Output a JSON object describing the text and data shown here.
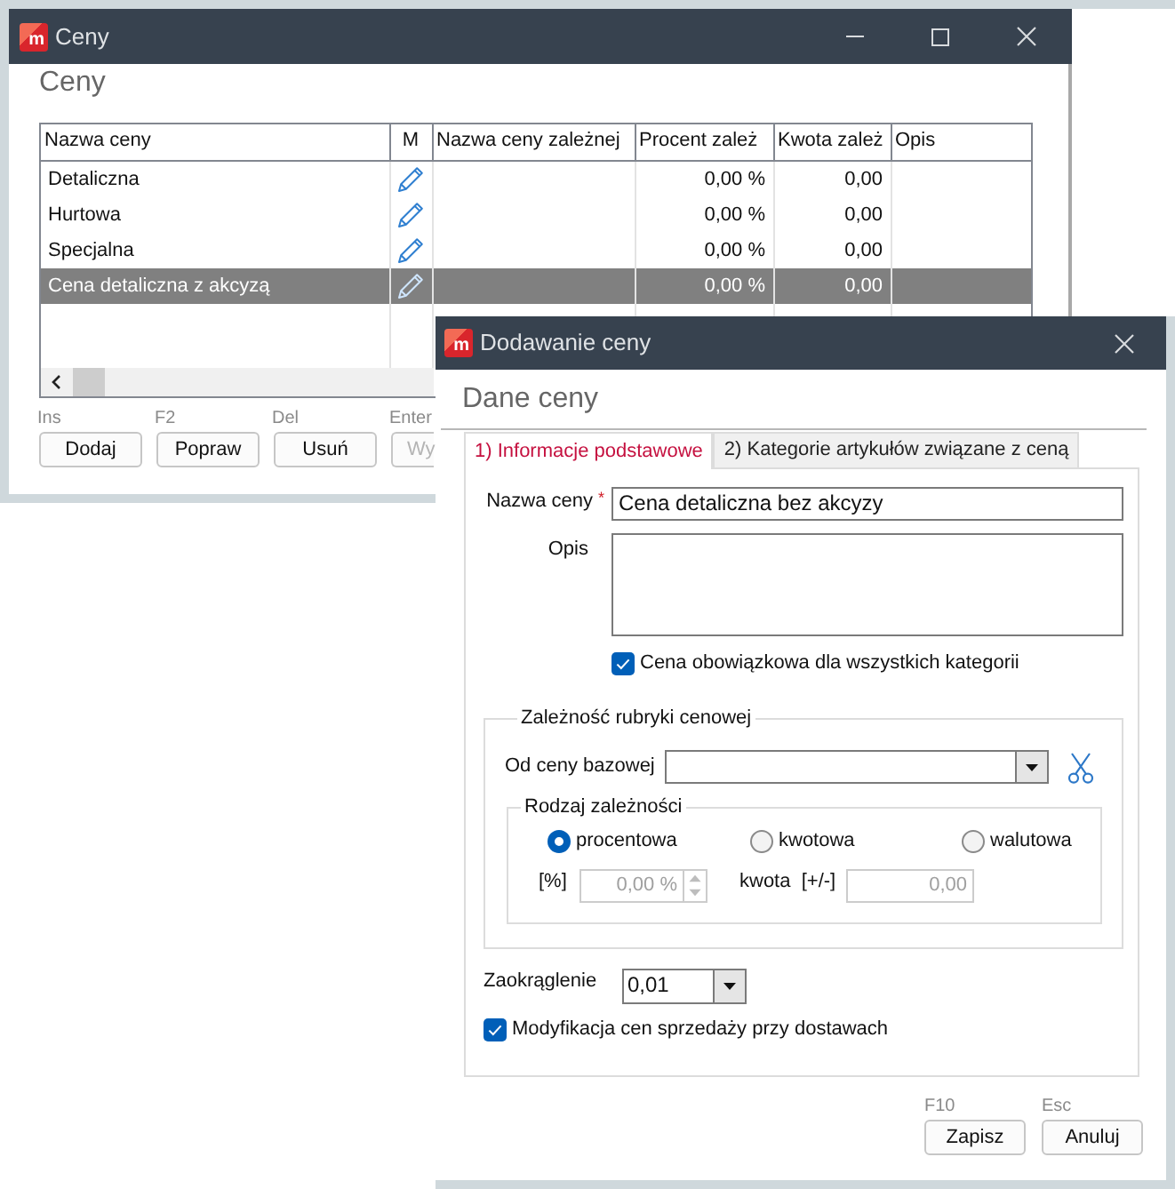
{
  "main_window": {
    "logo": "m",
    "title": "Ceny",
    "heading": "Ceny",
    "table": {
      "columns": [
        "Nazwa ceny",
        "M",
        "Nazwa ceny zależnej",
        "Procent zależ",
        "Kwota zależ",
        "Opis"
      ],
      "rows": [
        {
          "name": "Detaliczna",
          "percent": "0,00 %",
          "amount": "0,00",
          "selected": false
        },
        {
          "name": "Hurtowa",
          "percent": "0,00 %",
          "amount": "0,00",
          "selected": false
        },
        {
          "name": "Specjalna",
          "percent": "0,00 %",
          "amount": "0,00",
          "selected": false
        },
        {
          "name": "Cena detaliczna z akcyzą",
          "percent": "0,00 %",
          "amount": "0,00",
          "selected": true
        }
      ]
    },
    "actions": [
      {
        "shortcut": "Ins",
        "label": "Dodaj",
        "disabled": false
      },
      {
        "shortcut": "F2",
        "label": "Popraw",
        "disabled": false
      },
      {
        "shortcut": "Del",
        "label": "Usuń",
        "disabled": false
      },
      {
        "shortcut": "Enter",
        "label": "Wy",
        "disabled": true
      }
    ]
  },
  "dialog": {
    "logo": "m",
    "title": "Dodawanie ceny",
    "heading": "Dane ceny",
    "tabs": [
      {
        "label": "1) Informacje podstawowe",
        "selected": true
      },
      {
        "label": "2) Kategorie artykułów związane z ceną",
        "selected": false
      }
    ],
    "name_field": {
      "label": "Nazwa ceny",
      "required_mark": "*",
      "value": "Cena detaliczna bez akcyzy"
    },
    "description_field": {
      "label": "Opis"
    },
    "mandatory_checkbox": {
      "label": "Cena obowiązkowa dla wszystkich kategorii",
      "checked": true
    },
    "dependency_group": {
      "title": "Zależność rubryki cenowej",
      "base_price": {
        "label": "Od ceny bazowej"
      },
      "dependency_type": {
        "title": "Rodzaj zależności",
        "options": [
          {
            "label": "procentowa",
            "selected": true
          },
          {
            "label": "kwotowa",
            "selected": false
          },
          {
            "label": "walutowa",
            "selected": false
          }
        ],
        "percent_field": {
          "label": "[%]",
          "value": "0,00 %",
          "disabled": true
        },
        "amount_field": {
          "label": "kwota  [+/-]",
          "value": "0,00",
          "disabled": true
        }
      }
    },
    "rounding": {
      "label": "Zaokrąglenie",
      "value": "0,01"
    },
    "delivery_checkbox": {
      "label": "Modyfikacja cen sprzedaży przy dostawach",
      "checked": true
    },
    "buttons": [
      {
        "shortcut": "F10",
        "label": "Zapisz"
      },
      {
        "shortcut": "Esc",
        "label": "Anuluj"
      }
    ]
  }
}
